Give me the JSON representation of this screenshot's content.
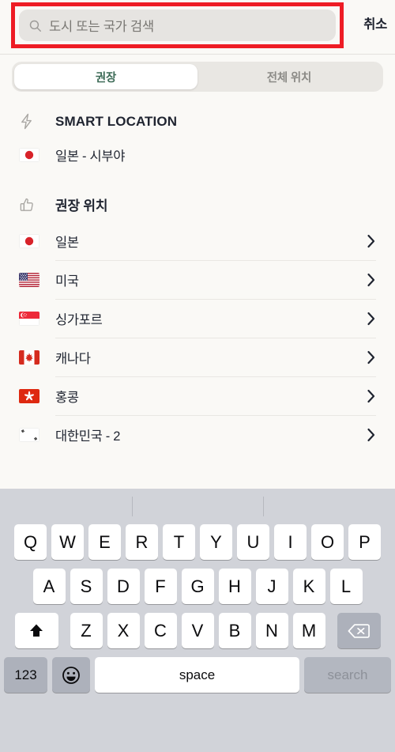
{
  "search": {
    "placeholder": "도시 또는 국가 검색",
    "value": "",
    "icon": "search-icon",
    "cancel_label": "취소",
    "highlight_color": "#ee1c25"
  },
  "tabs": {
    "items": [
      {
        "label": "권장",
        "active": true
      },
      {
        "label": "전체 위치",
        "active": false
      }
    ],
    "active_text_color": "#3d6b57",
    "inactive_text_color": "#8b8a86"
  },
  "sections": [
    {
      "id": "smart-location",
      "icon": "lightning-bolt-icon",
      "title": "SMART LOCATION",
      "rows": [
        {
          "flag": "jp",
          "label": "일본 - 시부야",
          "chevron": false,
          "divider": false
        }
      ]
    },
    {
      "id": "recommended-locations",
      "icon": "thumbs-up-icon",
      "title": "권장 위치",
      "rows": [
        {
          "flag": "jp",
          "label": "일본",
          "chevron": true,
          "divider": true
        },
        {
          "flag": "us",
          "label": "미국",
          "chevron": true,
          "divider": true
        },
        {
          "flag": "sg",
          "label": "싱가포르",
          "chevron": true,
          "divider": true
        },
        {
          "flag": "ca",
          "label": "캐나다",
          "chevron": true,
          "divider": true
        },
        {
          "flag": "hk",
          "label": "홍콩",
          "chevron": true,
          "divider": true
        },
        {
          "flag": "kr",
          "label": "대한민국 - 2",
          "chevron": true,
          "divider": false
        }
      ]
    }
  ],
  "keyboard": {
    "row1": [
      "Q",
      "W",
      "E",
      "R",
      "T",
      "Y",
      "U",
      "I",
      "O",
      "P"
    ],
    "row2": [
      "A",
      "S",
      "D",
      "F",
      "G",
      "H",
      "J",
      "K",
      "L"
    ],
    "row3": [
      "Z",
      "X",
      "C",
      "V",
      "B",
      "N",
      "M"
    ],
    "shift_icon": "shift-up-arrow-icon",
    "backspace_icon": "backspace-delete-icon",
    "numbers_label": "123",
    "emoji_icon": "emoji-smiley-icon",
    "space_label": "space",
    "search_label": "search",
    "search_enabled": false,
    "background_color": "#d1d3d9",
    "key_color": "#ffffff",
    "modifier_key_color": "#adb1bb"
  }
}
